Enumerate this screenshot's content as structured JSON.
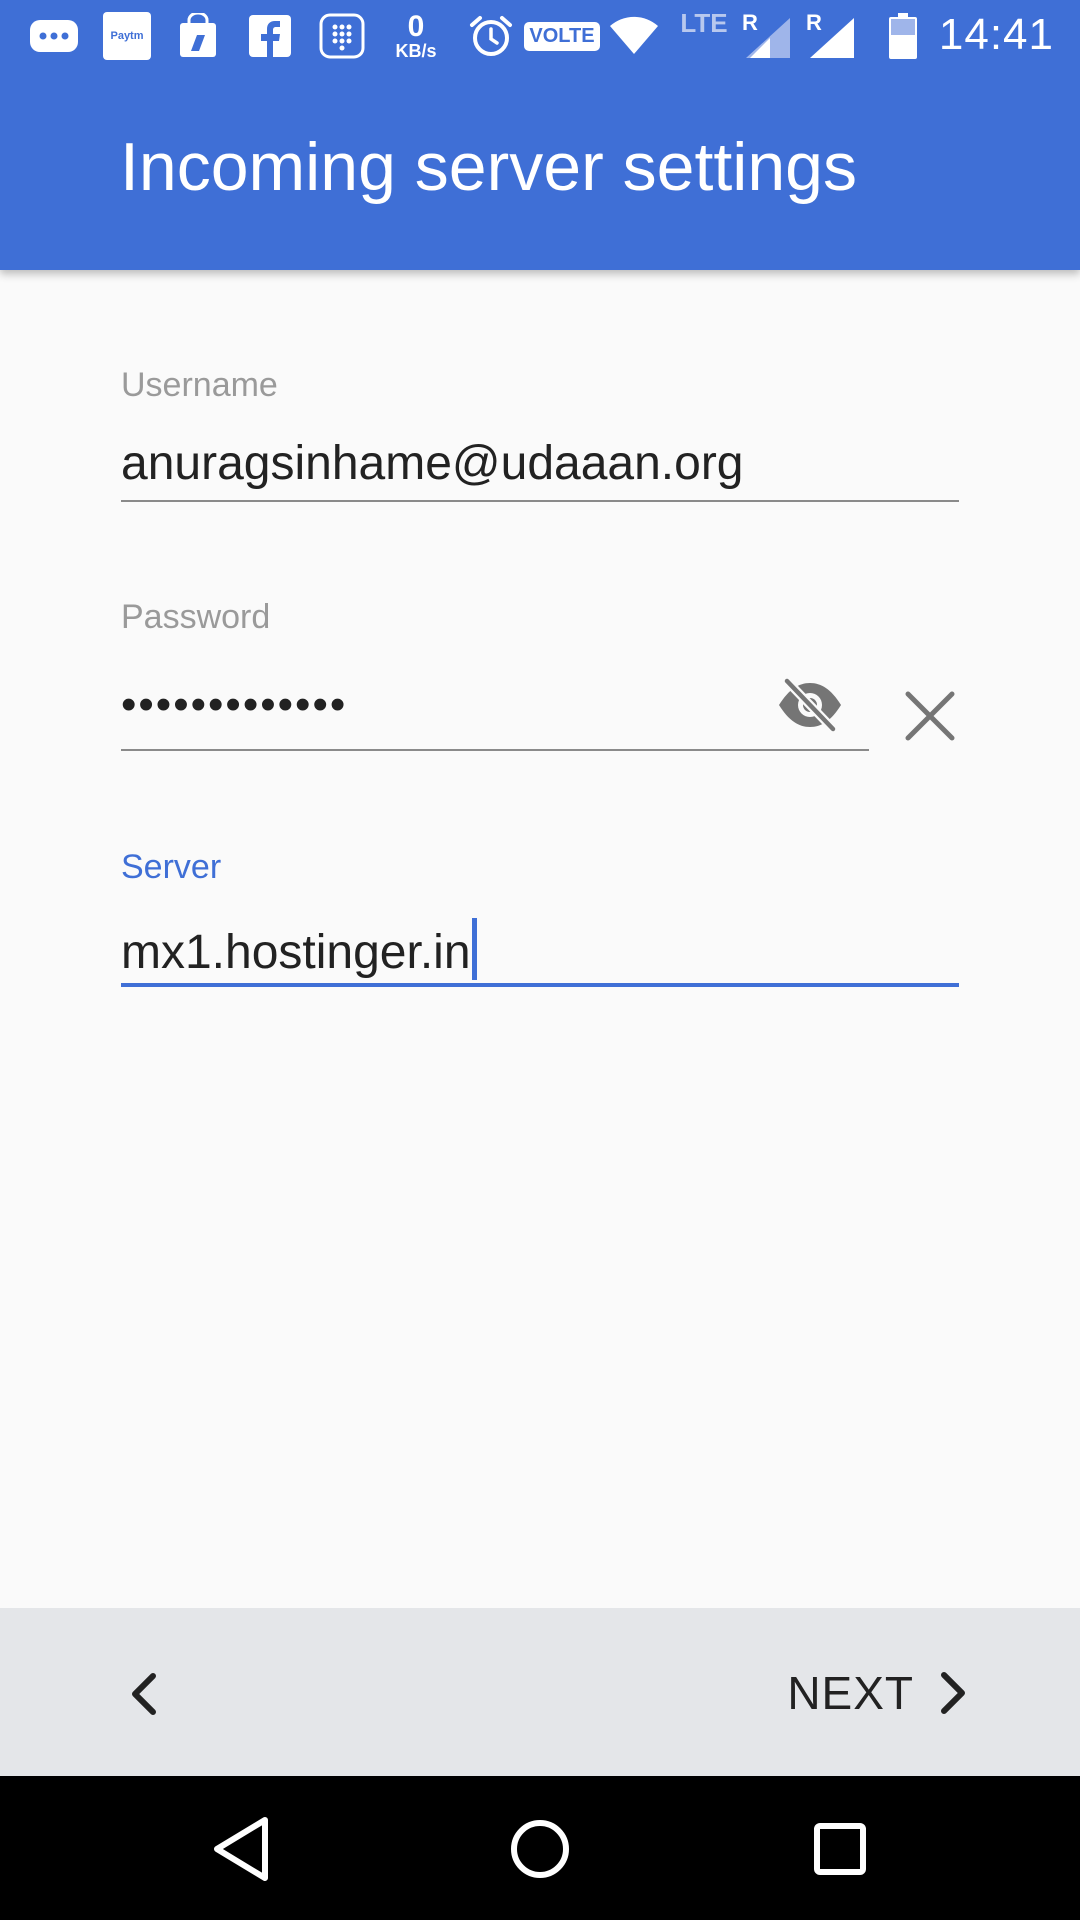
{
  "status_bar": {
    "time": "14:41",
    "data_speed_value": "0",
    "data_speed_unit": "KB/s",
    "volte_label": "VOLTE",
    "lte_label": "LTE",
    "roaming_label_1": "R",
    "roaming_label_2": "R",
    "paytm_label": "Paytm",
    "icons": [
      "messages-icon",
      "paytm-icon",
      "shopping-icon",
      "facebook-icon",
      "dialer-icon",
      "data-speed-icon",
      "alarm-icon",
      "volte-icon",
      "wifi-icon",
      "signal-icon",
      "signal-icon",
      "battery-icon"
    ]
  },
  "app_bar": {
    "title": "Incoming server settings"
  },
  "form": {
    "username": {
      "label": "Username",
      "value": "anuragsinhame@udaaan.org"
    },
    "password": {
      "label": "Password",
      "masked_value": "•••••••••••••",
      "visibility_icon": "eye-off-icon",
      "clear_icon": "close-icon"
    },
    "server": {
      "label": "Server",
      "value": "mx1.hostinger.in",
      "focused": true
    }
  },
  "action_bar": {
    "back_icon": "chevron-left-icon",
    "next_label": "NEXT",
    "next_icon": "chevron-right-icon"
  },
  "nav_bar": {
    "icons": [
      "nav-back-icon",
      "nav-home-icon",
      "nav-recents-icon"
    ]
  },
  "colors": {
    "primary": "#3f6fd6",
    "background": "#fafafa",
    "action_bar": "#e4e6e9",
    "label_gray": "#9a9a9a"
  }
}
